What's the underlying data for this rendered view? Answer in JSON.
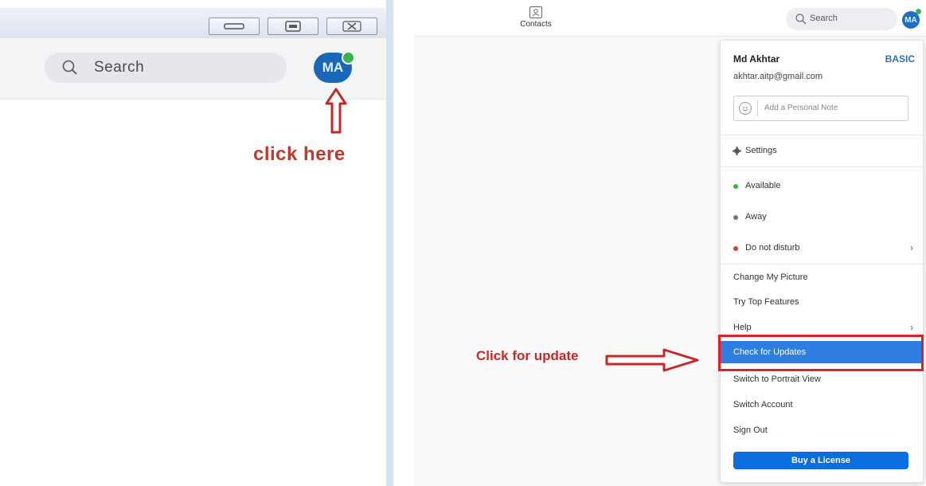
{
  "left_panel": {
    "search": {
      "placeholder": "Search"
    },
    "avatar": {
      "initials": "MA"
    },
    "annotation": {
      "text": "click here",
      "color": "#c0392b"
    }
  },
  "right_panel": {
    "topbar": {
      "contacts_label": "Contacts",
      "search_placeholder": "Search",
      "avatar_initials": "MA"
    },
    "menu": {
      "user_name": "Md Akhtar",
      "plan": "BASIC",
      "email": "akhtar.aitp@gmail.com",
      "note_placeholder": "Add a Personal Note",
      "items": [
        {
          "label": "Settings"
        },
        {
          "label": "Available"
        },
        {
          "label": "Away"
        },
        {
          "label": "Do not disturb"
        },
        {
          "label": "Change My Picture"
        },
        {
          "label": "Try Top Features"
        },
        {
          "label": "Help"
        },
        {
          "label": "Check for Updates"
        },
        {
          "label": "Switch to Portrait View"
        },
        {
          "label": "Switch Account"
        },
        {
          "label": "Sign Out"
        }
      ],
      "buy_button": "Buy a License"
    },
    "annotation": {
      "text": "Click for update",
      "color": "#c62828"
    }
  },
  "colors": {
    "accent": "#2e7de0",
    "available": "#3bb34a",
    "away": "#777777",
    "dnd": "#e53935",
    "highlight_border": "#e41e26"
  }
}
